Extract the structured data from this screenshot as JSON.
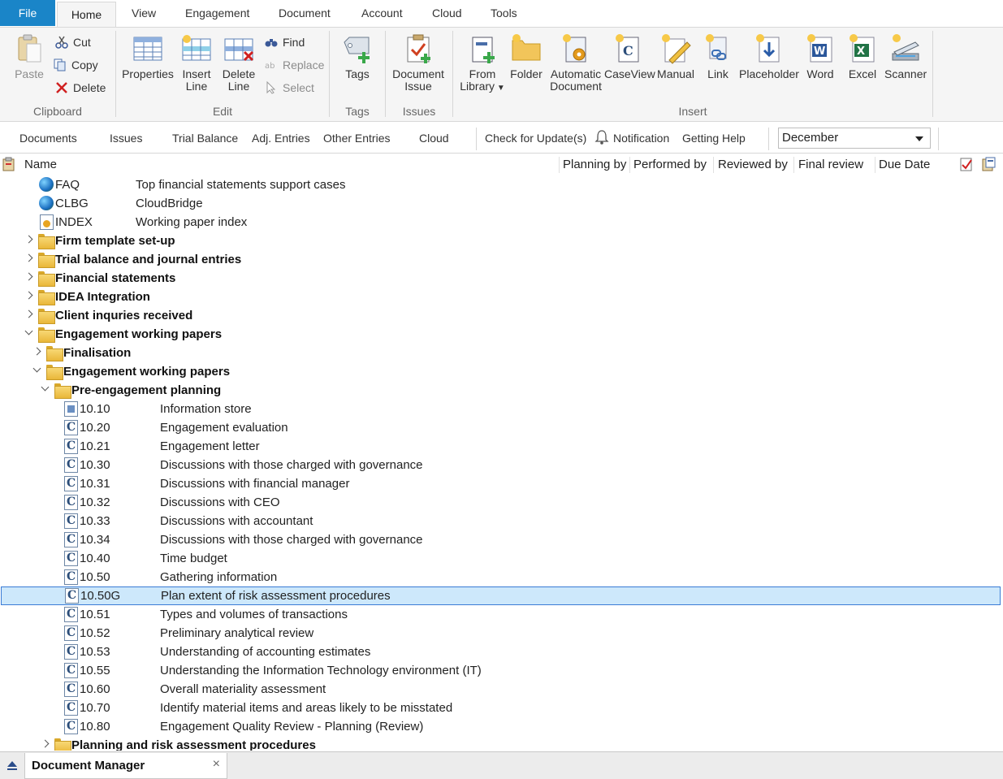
{
  "menu_tabs": {
    "file": "File",
    "home": "Home",
    "view": "View",
    "engagement": "Engagement",
    "document": "Document",
    "account": "Account",
    "cloud": "Cloud",
    "tools": "Tools"
  },
  "ribbon": {
    "clipboard": {
      "group": "Clipboard",
      "paste": "Paste",
      "cut": "Cut",
      "copy": "Copy",
      "delete": "Delete"
    },
    "edit": {
      "group": "Edit",
      "properties": "Properties",
      "insert_line_1": "Insert",
      "insert_line_2": "Line",
      "delete_line_1": "Delete",
      "delete_line_2": "Line",
      "find": "Find",
      "replace": "Replace",
      "select": "Select"
    },
    "tags": {
      "group": "Tags",
      "tags": "Tags"
    },
    "issues": {
      "group": "Issues",
      "doc_issue_1": "Document",
      "doc_issue_2": "Issue"
    },
    "insert": {
      "group": "Insert",
      "from_library_1": "From",
      "from_library_2": "Library",
      "folder": "Folder",
      "auto_doc_1": "Automatic",
      "auto_doc_2": "Document",
      "caseview": "CaseView",
      "manual": "Manual",
      "link": "Link",
      "placeholder": "Placeholder",
      "word": "Word",
      "excel": "Excel",
      "scanner": "Scanner"
    }
  },
  "toolbar2": {
    "documents": "Documents",
    "issues": "Issues",
    "trial_balance": "Trial Balance",
    "adj_entries": "Adj. Entries",
    "other_entries": "Other Entries",
    "cloud": "Cloud",
    "check_updates": "Check for Update(s)",
    "notification": "Notification",
    "getting_help": "Getting Help",
    "month": "December"
  },
  "columns": {
    "name": "Name",
    "planning_by": "Planning by",
    "performed_by": "Performed by",
    "reviewed_by": "Reviewed by",
    "final_review": "Final review",
    "due_date": "Due Date"
  },
  "tree": {
    "top_items": [
      {
        "code": "FAQ",
        "desc": "Top financial statements support cases"
      },
      {
        "code": "CLBG",
        "desc": "CloudBridge"
      },
      {
        "code": "INDEX",
        "desc": "Working paper index"
      }
    ],
    "folders": [
      "Firm template set-up",
      "Trial balance and journal entries",
      "Financial statements",
      "IDEA Integration",
      "Client inquries received",
      "Engagement working papers",
      "Finalisation",
      "Engagement working papers",
      "Pre-engagement planning",
      "Planning and risk assessment procedures"
    ],
    "docs": [
      {
        "code": "10.10",
        "desc": "Information store"
      },
      {
        "code": "10.20",
        "desc": "Engagement evaluation"
      },
      {
        "code": "10.21",
        "desc": "Engagement letter"
      },
      {
        "code": "10.30",
        "desc": "Discussions with those charged with governance"
      },
      {
        "code": "10.31",
        "desc": "Discussions with financial manager"
      },
      {
        "code": "10.32",
        "desc": "Discussions with CEO"
      },
      {
        "code": "10.33",
        "desc": "Discussions with accountant"
      },
      {
        "code": "10.34",
        "desc": "Discussions with those charged with governance"
      },
      {
        "code": "10.40",
        "desc": "Time budget"
      },
      {
        "code": "10.50",
        "desc": "Gathering information"
      },
      {
        "code": "10.50G",
        "desc": "Plan extent of risk assessment procedures"
      },
      {
        "code": "10.51",
        "desc": "Types and volumes of transactions"
      },
      {
        "code": "10.52",
        "desc": "Preliminary analytical review"
      },
      {
        "code": "10.53",
        "desc": "Understanding of accounting estimates"
      },
      {
        "code": "10.55",
        "desc": "Understanding the Information Technology environment (IT)"
      },
      {
        "code": "10.60",
        "desc": "Overall materiality assessment"
      },
      {
        "code": "10.70",
        "desc": "Identify material items and areas likely to be misstated"
      },
      {
        "code": "10.80",
        "desc": "Engagement Quality Review - Planning (Review)"
      }
    ]
  },
  "bottom_tab": {
    "title": "Document Manager",
    "close": "×"
  },
  "colors": {
    "file_tab": "#1a85c8",
    "selection_bg": "#cde8fb",
    "selection_border": "#3a7bd5"
  }
}
